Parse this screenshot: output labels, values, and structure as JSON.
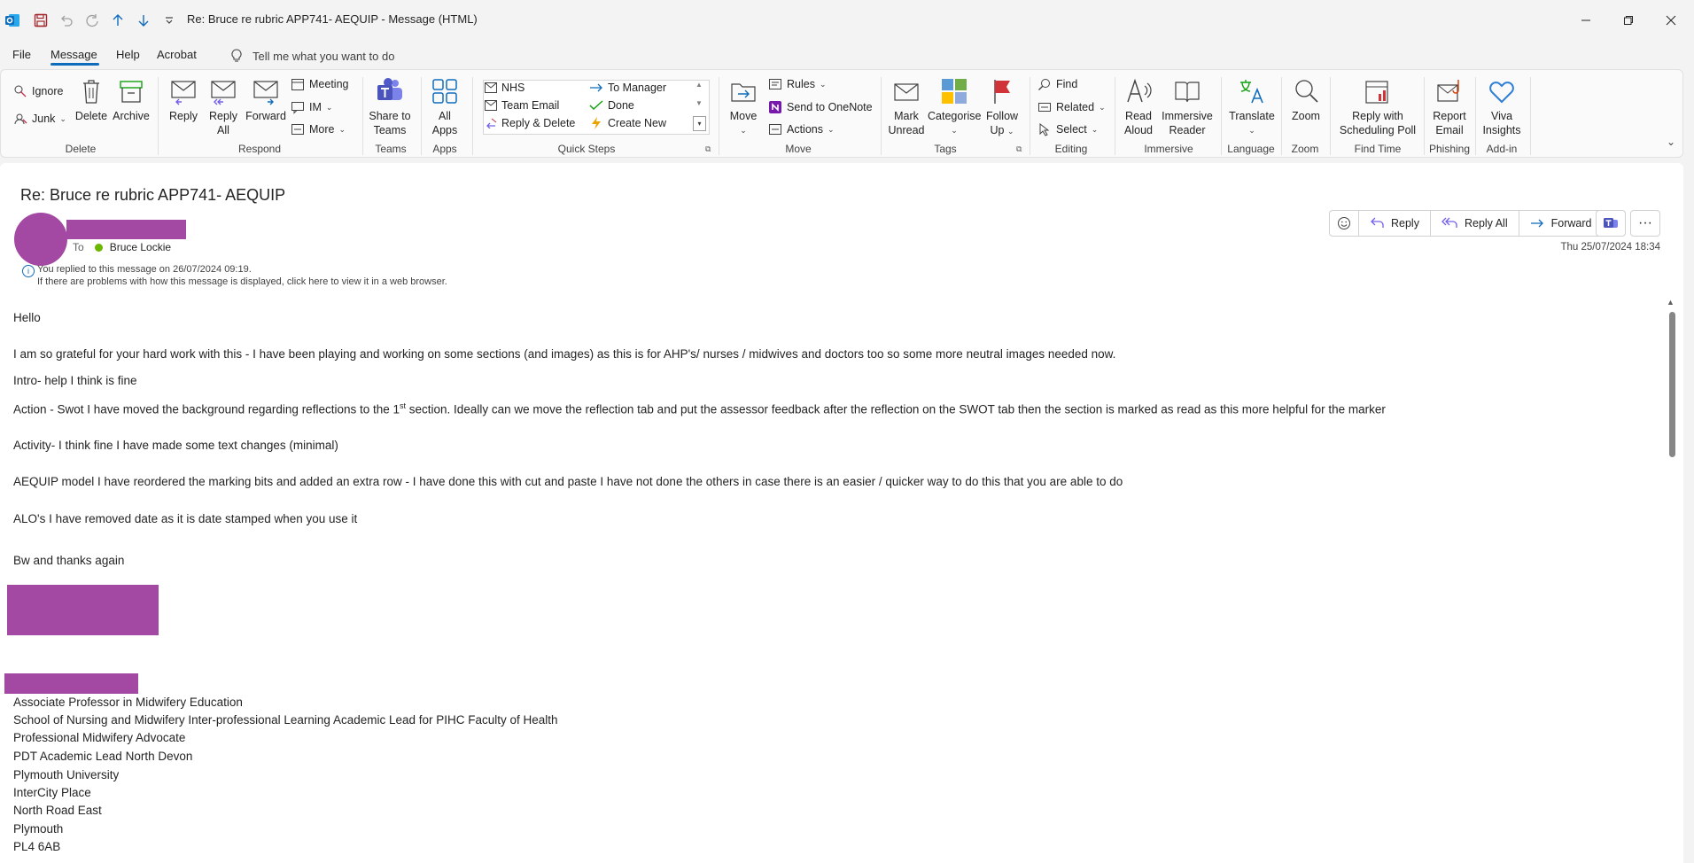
{
  "window": {
    "title": "Re: Bruce re rubric APP741- AEQUIP  - Message (HTML)",
    "accent": "#0f6cbd"
  },
  "menu": {
    "items": [
      "File",
      "Message",
      "Help",
      "Acrobat"
    ],
    "tellme": "Tell me what you want to do"
  },
  "ribbon": {
    "groups": {
      "delete": "Delete",
      "respond": "Respond",
      "teams": "Teams",
      "apps": "Apps",
      "quicksteps": "Quick Steps",
      "move": "Move",
      "tags": "Tags",
      "editing": "Editing",
      "immersive": "Immersive",
      "language": "Language",
      "zoom": "Zoom",
      "findtime": "Find Time",
      "phishing": "Phishing",
      "addin": "Add-in"
    },
    "ignore": "Ignore",
    "junk": "Junk",
    "delete": "Delete",
    "archive": "Archive",
    "reply": "Reply",
    "reply_all_1": "Reply",
    "reply_all_2": "All",
    "forward": "Forward",
    "meeting": "Meeting",
    "im": "IM",
    "more": "More",
    "share_teams_1": "Share to",
    "share_teams_2": "Teams",
    "all_apps_1": "All",
    "all_apps_2": "Apps",
    "qs_nhs": "NHS",
    "qs_team_email": "Team Email",
    "qs_reply_delete": "Reply & Delete",
    "qs_to_manager": "To Manager",
    "qs_done": "Done",
    "qs_create_new": "Create New",
    "move": "Move",
    "rules": "Rules",
    "send_onenote": "Send to OneNote",
    "actions": "Actions",
    "mark_unread_1": "Mark",
    "mark_unread_2": "Unread",
    "categorise": "Categorise",
    "follow_up_1": "Follow",
    "follow_up_2": "Up",
    "find": "Find",
    "related": "Related",
    "select": "Select",
    "read_aloud_1": "Read",
    "read_aloud_2": "Aloud",
    "immersive_reader_1": "Immersive",
    "immersive_reader_2": "Reader",
    "translate": "Translate",
    "zoom": "Zoom",
    "scheduling_poll_1": "Reply with",
    "scheduling_poll_2": "Scheduling Poll",
    "report_email_1": "Report",
    "report_email_2": "Email",
    "viva_1": "Viva",
    "viva_2": "Insights"
  },
  "message": {
    "subject": "Re: Bruce re rubric APP741- AEQUIP",
    "to_label": "To",
    "recipient": "Bruce Lockie",
    "replied_note": "You replied to this message on 26/07/2024 09:19.",
    "display_note": "If there are problems with how this message is displayed, click here to view it in a web browser.",
    "date": "Thu 25/07/2024 18:34",
    "actions": {
      "reply": "Reply",
      "reply_all": "Reply All",
      "forward": "Forward"
    },
    "redaction_color": "#a349a4",
    "body": {
      "greeting": "Hello",
      "p1": "I am so grateful for your hard work with this - I have been playing and working on some sections (and images) as this is for AHP's/ nurses / midwives and doctors too so some more neutral images needed now.",
      "p2": "Intro- help I think is fine",
      "p3_a": "Action - Swot I have moved the background regarding reflections to the 1",
      "p3_sup": "st",
      "p3_b": " section. Ideally can we move the reflection tab and put the assessor feedback after the reflection on the SWOT tab then the section is marked as read as this more helpful for the marker",
      "p4": "Activity- I think fine I have made some text changes (minimal)",
      "p5": "AEQUIP model I have reordered the marking bits and added an extra row - I have done this with cut and paste I have not done the others in case there is an easier / quicker way to do this that you are able to do",
      "p6": "ALO's I have removed date as it is date stamped when you use it",
      "p7": "Bw and thanks again"
    },
    "signature": [
      "Associate Professor in Midwifery Education",
      "School of Nursing and Midwifery  Inter-professional Learning Academic Lead for PIHC Faculty of Health",
      "Professional Midwifery Advocate",
      "PDT Academic Lead North Devon",
      "Plymouth University",
      "InterCity Place",
      "North Road East",
      "Plymouth",
      "PL4 6AB"
    ]
  }
}
